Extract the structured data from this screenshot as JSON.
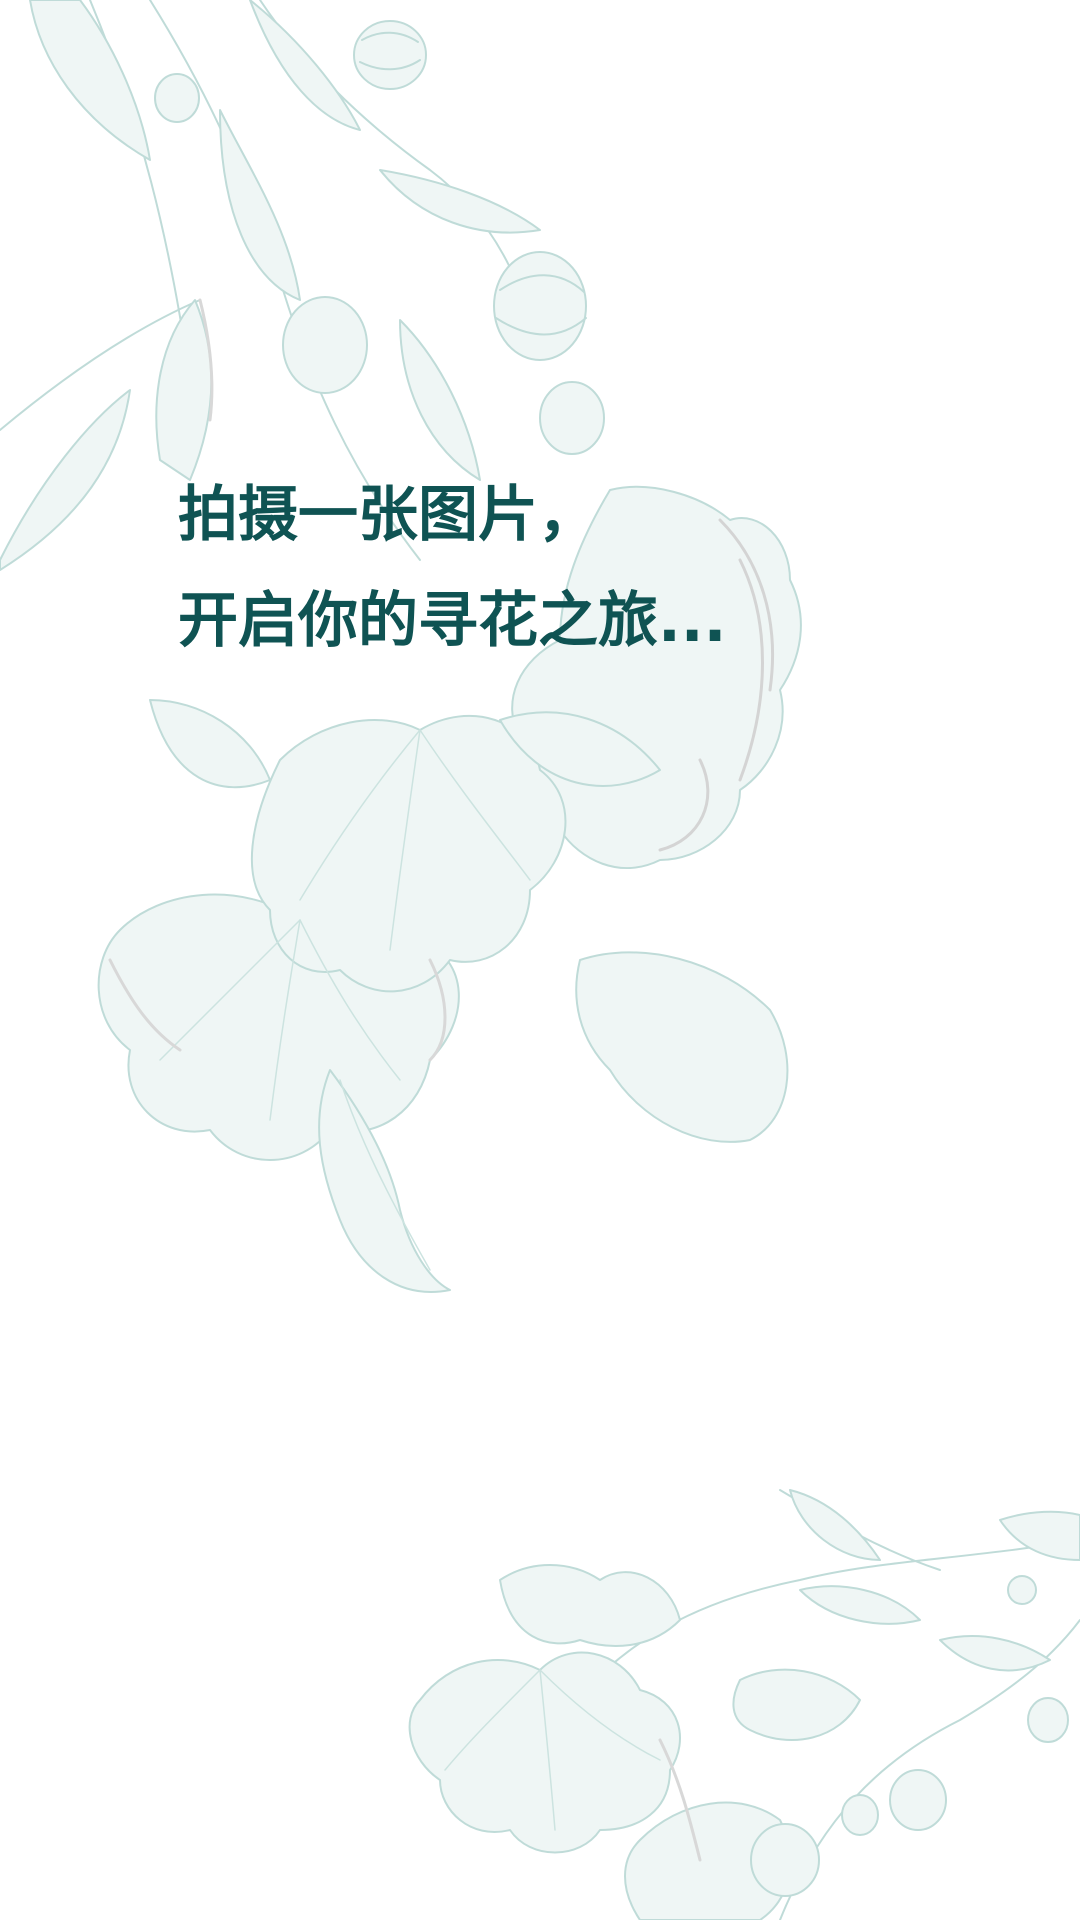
{
  "splash": {
    "line1": "拍摄一张图片，",
    "line2": "开启你的寻花之旅..."
  },
  "colors": {
    "headline": "#0f5353",
    "illustration_line": "#b9d8d4",
    "illustration_fill": "#eef6f4",
    "illustration_shadow": "#d4d4d4",
    "background": "#ffffff"
  },
  "icons": {
    "background": "floral-line-illustration"
  }
}
